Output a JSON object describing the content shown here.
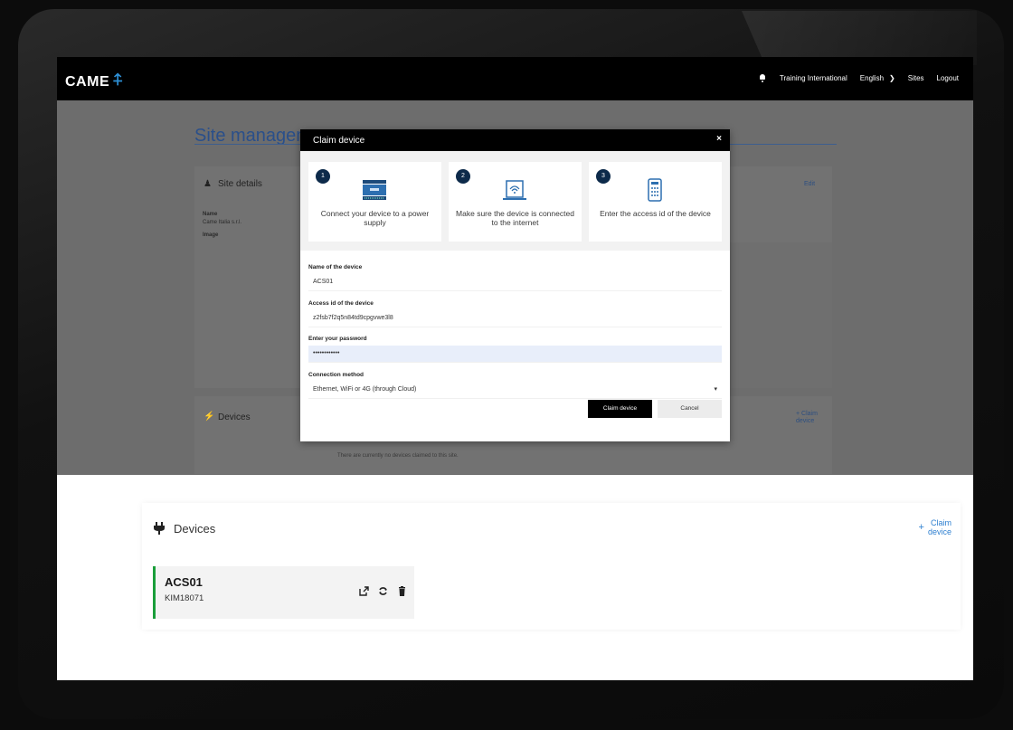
{
  "nav": {
    "logo": "CAME",
    "account": "Training International",
    "language": "English",
    "sites": "Sites",
    "logout": "Logout"
  },
  "background": {
    "page_title": "Site managem",
    "site_details": "Site details",
    "name_label": "Name",
    "name_value": "Came Italia s.r.l.",
    "image_label": "Image",
    "edit": "Edit",
    "devices": "Devices",
    "claim": "+ Claim device",
    "empty_note": "There are currently no devices claimed to this site."
  },
  "modal": {
    "title": "Claim device",
    "close": "×",
    "steps": [
      {
        "num": "1",
        "text": "Connect your device to a power supply"
      },
      {
        "num": "2",
        "text": "Make sure the device is connected to the internet"
      },
      {
        "num": "3",
        "text": "Enter the access id of the device"
      }
    ],
    "fields": {
      "name_label": "Name of the device",
      "name_value": "ACS01",
      "access_label": "Access id of the device",
      "access_value": "z2fsb7f2q5n84td9cpgvwe3l8",
      "password_label": "Enter your password",
      "password_value": "••••••••••••",
      "method_label": "Connection method",
      "method_value": "Ethernet, WiFi or 4G (through Cloud)"
    },
    "claim_button": "Claim device",
    "cancel_button": "Cancel"
  },
  "devices_panel": {
    "title": "Devices",
    "claim_line1": "Claim",
    "claim_line2": "device",
    "device": {
      "name": "ACS01",
      "id": "KIM18071"
    }
  },
  "colors": {
    "accent_blue": "#2d7fd0",
    "step_circle": "#0d2a4a",
    "status_green": "#1a9e3a"
  }
}
